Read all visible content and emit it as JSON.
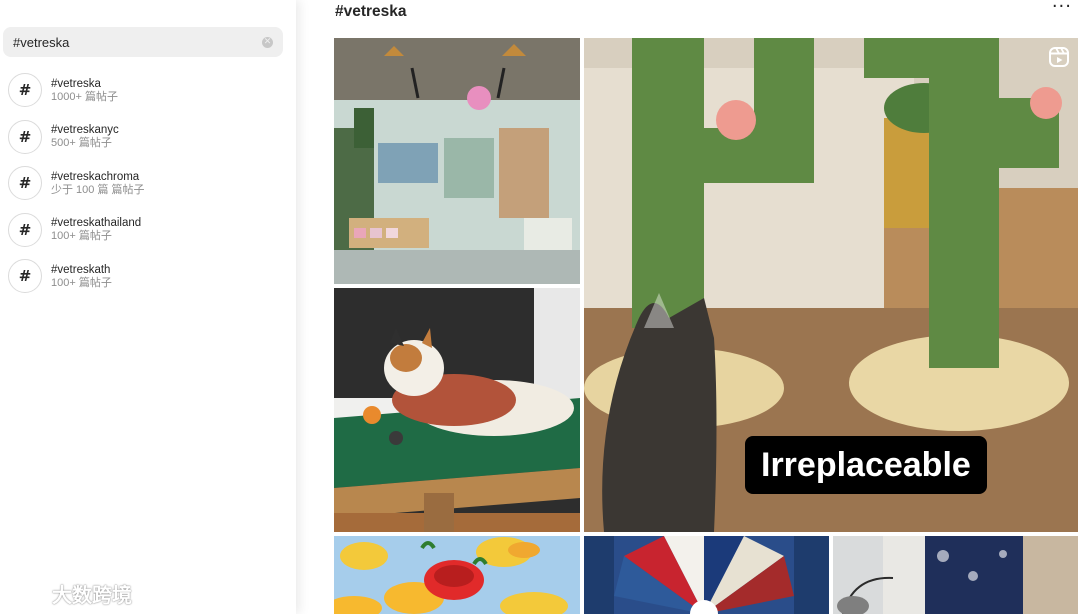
{
  "search": {
    "value": "#vetreska",
    "clear_icon": "clear-circle-icon"
  },
  "results": [
    {
      "name": "#vetreska",
      "count": "1000+ 篇帖子"
    },
    {
      "name": "#vetreskanyc",
      "count": "500+ 篇帖子"
    },
    {
      "name": "#vetreskachroma",
      "count": "少于 100 篇 篇帖子"
    },
    {
      "name": "#vetreskathailand",
      "count": "100+ 篇帖子"
    },
    {
      "name": "#vetreskath",
      "count": "100+ 篇帖子"
    }
  ],
  "result_icon_text": "#",
  "main": {
    "title": "#vetreska",
    "more_label": "···"
  },
  "posts": [
    {
      "kind": "storefront"
    },
    {
      "kind": "reel",
      "caption": "Irreplaceable",
      "badge_icon": "reels-icon"
    },
    {
      "kind": "cat-pool-table"
    },
    {
      "kind": "pet-bowls"
    },
    {
      "kind": "pennants"
    },
    {
      "kind": "room-lamp"
    }
  ],
  "watermark": {
    "text": "大数跨境"
  }
}
